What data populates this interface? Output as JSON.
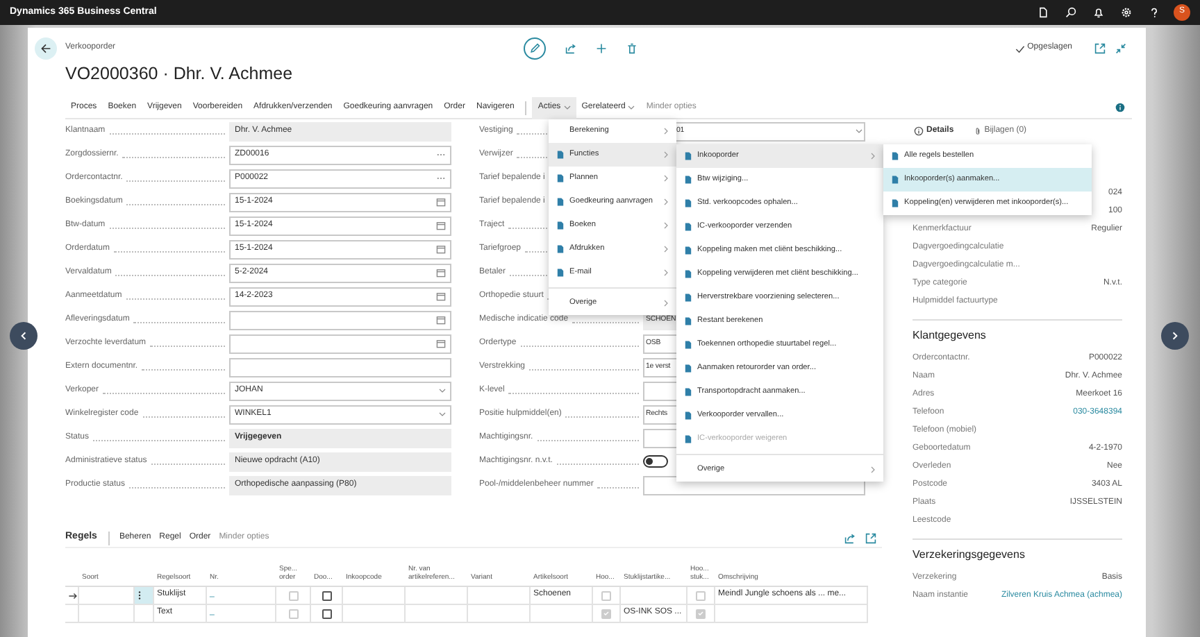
{
  "app_title": "Dynamics 365 Business Central",
  "user_initial": "S",
  "page": {
    "breadcrumb": "Verkooporder",
    "title": "VO2000360 · Dhr. V. Achmee",
    "save_status": "Opgeslagen"
  },
  "action_bar": [
    {
      "label": "Proces",
      "kind": "plain",
      "selected": false
    },
    {
      "label": "Boeken",
      "kind": "plain",
      "selected": false
    },
    {
      "label": "Vrijgeven",
      "kind": "plain",
      "selected": false
    },
    {
      "label": "Voorbereiden",
      "kind": "plain",
      "selected": false
    },
    {
      "label": "Afdrukken/verzenden",
      "kind": "plain",
      "selected": false
    },
    {
      "label": "Goedkeuring aanvragen",
      "kind": "plain",
      "selected": false
    },
    {
      "label": "Order",
      "kind": "plain",
      "selected": false
    },
    {
      "label": "Navigeren",
      "kind": "plain",
      "selected": false
    },
    {
      "label": "Acties",
      "kind": "dropdown",
      "selected": true
    },
    {
      "label": "Gerelateerd",
      "kind": "dropdown",
      "selected": false
    },
    {
      "label": "Minder opties",
      "kind": "muted",
      "selected": false
    }
  ],
  "general_left": [
    {
      "label": "Klantnaam",
      "value": "Dhr. V. Achmee",
      "kind": "readonly"
    },
    {
      "label": "Zorgdossiernr.",
      "value": "ZD00016",
      "kind": "lookup"
    },
    {
      "label": "Ordercontactnr.",
      "value": "P000022",
      "kind": "lookup"
    },
    {
      "label": "Boekingsdatum",
      "value": "15-1-2024",
      "kind": "date"
    },
    {
      "label": "Btw-datum",
      "value": "15-1-2024",
      "kind": "date"
    },
    {
      "label": "Orderdatum",
      "value": "15-1-2024",
      "kind": "date"
    },
    {
      "label": "Vervaldatum",
      "value": "5-2-2024",
      "kind": "date"
    },
    {
      "label": "Aanmeetdatum",
      "value": "14-2-2023",
      "kind": "date"
    },
    {
      "label": "Afleveringsdatum",
      "kind": "date"
    },
    {
      "label": "Verzochte leverdatum",
      "kind": "date"
    },
    {
      "label": "Extern documentnr.",
      "kind": "text"
    },
    {
      "label": "Verkoper",
      "value": "JOHAN",
      "kind": "select"
    },
    {
      "label": "Winkelregister code",
      "value": "WINKEL1",
      "kind": "select"
    },
    {
      "label": "Status",
      "value": "Vrijgegeven",
      "kind": "status"
    },
    {
      "label": "Administratieve status",
      "value": "Nieuwe opdracht (A10)",
      "kind": "readonly"
    },
    {
      "label": "Productie status",
      "value": "Orthopedische aanpassing (P80)",
      "kind": "readonly"
    }
  ],
  "general_middle": [
    {
      "label": "Vestiging",
      "value": "01",
      "kind": "select"
    },
    {
      "label": "Verwijzer"
    },
    {
      "label": "Tarief bepalende i"
    },
    {
      "label": "Tarief bepalende i"
    },
    {
      "label": "Traject"
    },
    {
      "label": "Tariefgroep"
    },
    {
      "label": "Betaler"
    },
    {
      "label": "Orthopedie stuurt"
    },
    {
      "label": "Medische indicatie code",
      "value": "SCHOEN",
      "kind": "readonly"
    },
    {
      "label": "Ordertype",
      "value": "OSB",
      "kind": "text"
    },
    {
      "label": "Verstrekking",
      "value": "1e verst",
      "kind": "text"
    },
    {
      "label": "K-level",
      "kind": "text"
    },
    {
      "label": "Positie hulpmiddel(en)",
      "value": "Rechts",
      "kind": "text"
    },
    {
      "label": "Machtigingsnr.",
      "kind": "text"
    },
    {
      "label": "Machtigingsnr. n.v.t.",
      "kind": "toggle",
      "on": false
    },
    {
      "label": "Pool-/middelenbeheer nummer",
      "kind": "text"
    }
  ],
  "actions_menu": [
    {
      "label": "Berekening",
      "icon": false,
      "selected": false,
      "divider_before": false
    },
    {
      "label": "Functies",
      "icon": true,
      "selected": true,
      "divider_before": false
    },
    {
      "label": "Plannen",
      "icon": true,
      "selected": false,
      "divider_before": false
    },
    {
      "label": "Goedkeuring aanvragen",
      "icon": true,
      "selected": false,
      "divider_before": false
    },
    {
      "label": "Boeken",
      "icon": true,
      "selected": false,
      "divider_before": false
    },
    {
      "label": "Afdrukken",
      "icon": true,
      "selected": false,
      "divider_before": false
    },
    {
      "label": "E-mail",
      "icon": true,
      "selected": false,
      "divider_before": false
    },
    {
      "label": "Overige",
      "icon": false,
      "selected": false,
      "divider_before": true
    }
  ],
  "functions_submenu": [
    {
      "label": "Inkooporder",
      "icon": true,
      "submenu": true,
      "selected": true,
      "disabled": false,
      "divider_before": false
    },
    {
      "label": "Btw wijziging...",
      "icon": true,
      "submenu": false,
      "selected": false,
      "disabled": false,
      "divider_before": false
    },
    {
      "label": "Std. verkoopcodes ophalen...",
      "icon": true,
      "submenu": false,
      "selected": false,
      "disabled": false,
      "divider_before": false
    },
    {
      "label": "IC-verkooporder verzenden",
      "icon": true,
      "submenu": false,
      "selected": false,
      "disabled": false,
      "divider_before": false
    },
    {
      "label": "Koppeling maken met cliënt beschikking...",
      "icon": true,
      "submenu": false,
      "selected": false,
      "disabled": false,
      "divider_before": false
    },
    {
      "label": "Koppeling verwijderen met cliënt beschikking...",
      "icon": true,
      "submenu": false,
      "selected": false,
      "disabled": false,
      "divider_before": false
    },
    {
      "label": "Herverstrekbare voorziening selecteren...",
      "icon": true,
      "submenu": false,
      "selected": false,
      "disabled": false,
      "divider_before": false
    },
    {
      "label": "Restant berekenen",
      "icon": true,
      "submenu": false,
      "selected": false,
      "disabled": false,
      "divider_before": false
    },
    {
      "label": "Toekennen orthopedie stuurtabel regel...",
      "icon": true,
      "submenu": false,
      "selected": false,
      "disabled": false,
      "divider_before": false
    },
    {
      "label": "Aanmaken retourorder van order...",
      "icon": true,
      "submenu": false,
      "selected": false,
      "disabled": false,
      "divider_before": false
    },
    {
      "label": "Transportopdracht aanmaken...",
      "icon": true,
      "submenu": false,
      "selected": false,
      "disabled": false,
      "divider_before": false
    },
    {
      "label": "Verkooporder vervallen...",
      "icon": true,
      "submenu": false,
      "selected": false,
      "disabled": false,
      "divider_before": false
    },
    {
      "label": "IC-verkooporder weigeren",
      "icon": true,
      "submenu": false,
      "selected": false,
      "disabled": true,
      "divider_before": false
    },
    {
      "label": "Overige",
      "icon": false,
      "submenu": true,
      "selected": false,
      "disabled": false,
      "divider_before": true
    }
  ],
  "purchase_submenu": [
    {
      "label": "Alle regels bestellen",
      "selected": false
    },
    {
      "label": "Inkooporder(s) aanmaken...",
      "selected": true
    },
    {
      "label": "Koppeling(en) verwijderen met inkooporder(s)...",
      "selected": false
    }
  ],
  "factbox": {
    "tabs": [
      {
        "label": "Details",
        "selected": true
      },
      {
        "label": "Bijlagen (0)",
        "selected": false
      }
    ],
    "sections": [
      {
        "rows": [
          {
            "value": "024"
          },
          {
            "value": "100"
          },
          {
            "label": "Kenmerkfactuur",
            "value": "Regulier"
          },
          {
            "label": "Dagvergoedingcalculatie"
          },
          {
            "label": "Dagvergoedingcalculatie m..."
          },
          {
            "label": "Type categorie",
            "value": "N.v.t."
          },
          {
            "label": "Hulpmiddel factuurtype"
          }
        ]
      },
      {
        "heading": "Klantgegevens",
        "rows": [
          {
            "label": "Ordercontactnr.",
            "value": "P000022"
          },
          {
            "label": "Naam",
            "value": "Dhr. V. Achmee"
          },
          {
            "label": "Adres",
            "value": "Meerkoet 16"
          },
          {
            "label": "Telefoon",
            "value": "030-3648394",
            "link": true
          },
          {
            "label": "Telefoon (mobiel)"
          },
          {
            "label": "Geboortedatum",
            "value": "4-2-1970"
          },
          {
            "label": "Overleden",
            "value": "Nee"
          },
          {
            "label": "Postcode",
            "value": "3403 AL"
          },
          {
            "label": "Plaats",
            "value": "IJSSELSTEIN"
          },
          {
            "label": "Leestcode"
          }
        ]
      },
      {
        "heading": "Verzekeringsgegevens",
        "rows": [
          {
            "label": "Verzekering",
            "value": "Basis"
          },
          {
            "label": "Naam instantie",
            "value": "Zilveren Kruis Achmea (achmea)",
            "link": true
          }
        ]
      }
    ]
  },
  "lines": {
    "title": "Regels",
    "actions": [
      {
        "label": "Beheren",
        "kind": "plain"
      },
      {
        "label": "Regel",
        "kind": "plain"
      },
      {
        "label": "Order",
        "kind": "plain"
      },
      {
        "label": "Minder opties",
        "kind": "muted"
      }
    ],
    "columns": [
      {},
      {
        "label": "Soort"
      },
      {},
      {
        "label": "Regelsoort"
      },
      {
        "label": "Nr."
      },
      {
        "label": "Spe... order"
      },
      {
        "label": "Doo..."
      },
      {
        "label": "Inkoopcode"
      },
      {
        "label": "Nr. van artikelreferen..."
      },
      {
        "label": "Variant"
      },
      {
        "label": "Artikelsoort"
      },
      {
        "label": "Hoo..."
      },
      {
        "label": "Stuklijstartike..."
      },
      {
        "label": "Hoo... stuk..."
      },
      {
        "label": "Omschrijving"
      }
    ],
    "rows": [
      {
        "selected": true,
        "cells": [
          {},
          {},
          {},
          {
            "kind": "text",
            "text": "Stuklijst"
          },
          {
            "kind": "link",
            "text": "_"
          },
          {
            "kind": "check",
            "checked": false,
            "disabled": true
          },
          {
            "kind": "check",
            "checked": false,
            "disabled": false
          },
          {},
          {},
          {},
          {
            "kind": "text",
            "text": "Schoenen"
          },
          {
            "kind": "check",
            "checked": false,
            "disabled": true
          },
          {},
          {
            "kind": "check",
            "checked": false,
            "disabled": true
          },
          {
            "kind": "text",
            "text": "Meindl Jungle schoens als ... me..."
          }
        ]
      },
      {
        "selected": false,
        "cells": [
          {},
          {},
          {},
          {
            "kind": "text",
            "text": "Text"
          },
          {
            "kind": "link",
            "text": "_"
          },
          {
            "kind": "check",
            "checked": false,
            "disabled": true
          },
          {
            "kind": "check",
            "checked": false,
            "disabled": false
          },
          {},
          {},
          {},
          {},
          {
            "kind": "check",
            "checked": true,
            "disabled": true
          },
          {
            "kind": "text",
            "text": "OS-INK SOS ..."
          },
          {
            "kind": "check",
            "checked": true,
            "disabled": true
          },
          {}
        ]
      }
    ]
  }
}
